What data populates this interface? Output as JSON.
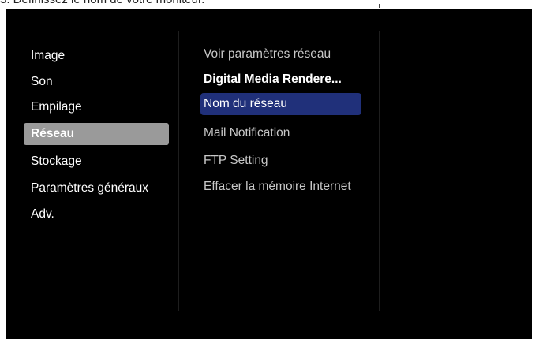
{
  "caption": "5.   Définissez le nom de votre moniteur.",
  "main_menu": {
    "items": [
      {
        "label": "Image",
        "selected": false
      },
      {
        "label": "Son",
        "selected": false
      },
      {
        "label": "Empilage",
        "selected": false
      },
      {
        "label": "Réseau",
        "selected": true
      },
      {
        "label": "Stockage",
        "selected": false
      },
      {
        "label": "Paramètres généraux",
        "selected": false
      },
      {
        "label": "Adv.",
        "selected": false
      }
    ]
  },
  "submenu": {
    "items": [
      {
        "label": "Voir paramètres réseau"
      },
      {
        "label": "Digital Media Rendere..."
      },
      {
        "label": "Nom du réseau"
      },
      {
        "label": "Mail Notification"
      },
      {
        "label": "FTP Setting"
      },
      {
        "label": "Effacer la mémoire Internet"
      }
    ]
  },
  "colors": {
    "screen_background": "#000000",
    "main_selected_background": "#9a9a9a",
    "submenu_highlight": "#20307a",
    "text": "#ffffff"
  }
}
